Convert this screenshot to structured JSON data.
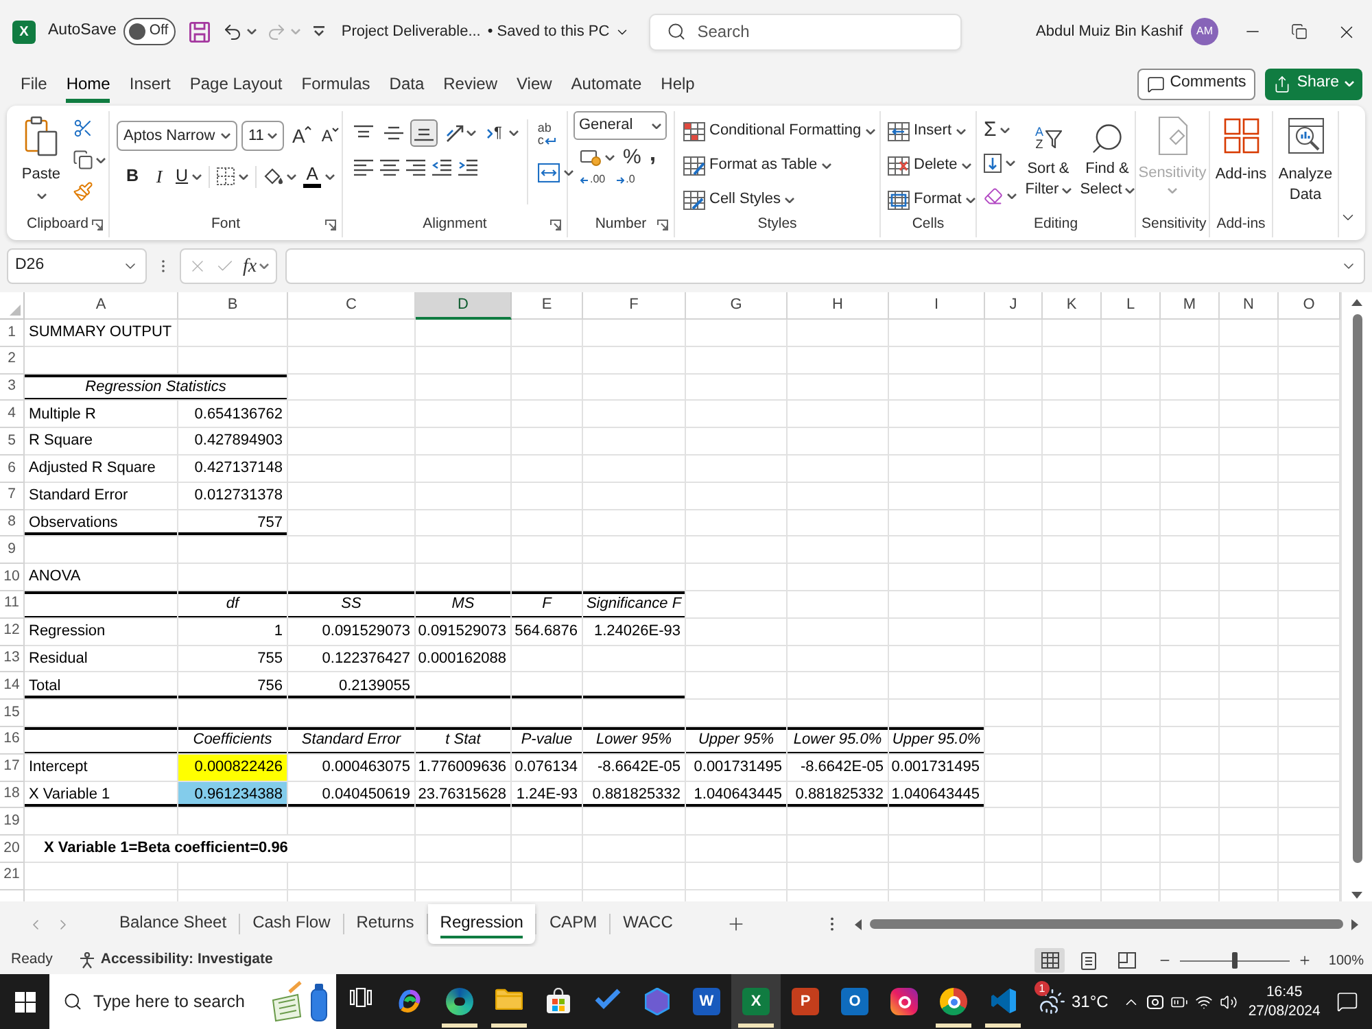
{
  "title_bar": {
    "app_glyph": "X",
    "autosave": "AutoSave",
    "autosave_state": "Off",
    "autosave_on": false,
    "document": "Project Deliverable...",
    "save_status": "• Saved to this PC",
    "search_placeholder": "Search",
    "user": "Abdul Muiz Bin Kashif",
    "initials": "AM"
  },
  "menu": {
    "tabs": [
      {
        "label": "File",
        "selected": false
      },
      {
        "label": "Home",
        "selected": true
      },
      {
        "label": "Insert",
        "selected": false
      },
      {
        "label": "Page Layout",
        "selected": false
      },
      {
        "label": "Formulas",
        "selected": false
      },
      {
        "label": "Data",
        "selected": false
      },
      {
        "label": "Review",
        "selected": false
      },
      {
        "label": "View",
        "selected": false
      },
      {
        "label": "Automate",
        "selected": false
      },
      {
        "label": "Help",
        "selected": false
      }
    ],
    "comments": "Comments",
    "share": "Share"
  },
  "ribbon": {
    "clipboard": {
      "paste": "Paste",
      "label": "Clipboard"
    },
    "font": {
      "name": "Aptos Narrow",
      "size": "11",
      "grow": "A",
      "shrink": "A",
      "bold": "B",
      "italic": "I",
      "underline": "U",
      "color_letter": "A",
      "label": "Font"
    },
    "alignment": {
      "vertical": [
        {
          "kind": "top",
          "selected": false
        },
        {
          "kind": "middle",
          "selected": false
        },
        {
          "kind": "bottom",
          "selected": true
        }
      ],
      "direction_glyph": "¶",
      "wrap": [
        "ab",
        "c"
      ],
      "label": "Alignment"
    },
    "number": {
      "format": "General",
      "percent": "%",
      "comma": ",",
      "more_decimals": ".00",
      "fewer_decimals": ".0",
      "label": "Number"
    },
    "styles": {
      "items": [
        "Conditional Formatting",
        "Format as Table",
        "Cell Styles"
      ],
      "label": "Styles"
    },
    "cells": {
      "items": [
        "Insert",
        "Delete",
        "Format"
      ],
      "label": "Cells"
    },
    "editing": {
      "sum": "Σ",
      "sort_letters": [
        "A",
        "Z"
      ],
      "sort": [
        "Sort &",
        "Filter"
      ],
      "find": [
        "Find &",
        "Select"
      ],
      "label": "Editing"
    },
    "sensitivity": {
      "button": "Sensitivity",
      "disabled": true,
      "label": "Sensitivity"
    },
    "addins": {
      "button": "Add-ins",
      "label": "Add-ins"
    },
    "analyze": {
      "button": [
        "Analyze",
        "Data"
      ]
    }
  },
  "formula_bar": {
    "name_box": "D26",
    "fx": "fx"
  },
  "sheet": {
    "columns": [
      {
        "label": "A",
        "selected": false
      },
      {
        "label": "B",
        "selected": false
      },
      {
        "label": "C",
        "selected": false
      },
      {
        "label": "D",
        "selected": true
      },
      {
        "label": "E",
        "selected": false
      },
      {
        "label": "F",
        "selected": false
      },
      {
        "label": "G",
        "selected": false
      },
      {
        "label": "H",
        "selected": false
      },
      {
        "label": "I",
        "selected": false
      },
      {
        "label": "J",
        "selected": false
      },
      {
        "label": "K",
        "selected": false
      },
      {
        "label": "L",
        "selected": false
      },
      {
        "label": "M",
        "selected": false
      },
      {
        "label": "N",
        "selected": false
      },
      {
        "label": "O",
        "selected": false
      }
    ],
    "rows": [
      {
        "number": "1",
        "cells": [
          {
            "kind": "label",
            "text": "SUMMARY OUTPUT"
          }
        ]
      },
      {
        "number": "2"
      },
      {
        "number": "3",
        "kind": "table-head",
        "cells": [
          {
            "kind": "heading",
            "text": "Regression Statistics"
          },
          {
            "kind": "merged"
          }
        ]
      },
      {
        "number": "4",
        "cells": [
          {
            "kind": "label",
            "text": "Multiple R"
          },
          {
            "kind": "number",
            "text": "0.654136762"
          }
        ]
      },
      {
        "number": "5",
        "cells": [
          {
            "kind": "label",
            "text": "R Square"
          },
          {
            "kind": "number",
            "text": "0.427894903"
          }
        ]
      },
      {
        "number": "6",
        "cells": [
          {
            "kind": "label",
            "text": "Adjusted R Square"
          },
          {
            "kind": "number",
            "text": "0.427137148"
          }
        ]
      },
      {
        "number": "7",
        "cells": [
          {
            "kind": "label",
            "text": "Standard Error"
          },
          {
            "kind": "number",
            "text": "0.012731378"
          }
        ]
      },
      {
        "number": "8",
        "kind": "table-end",
        "cells": [
          {
            "kind": "label",
            "text": "Observations"
          },
          {
            "kind": "number",
            "text": "757"
          }
        ]
      },
      {
        "number": "9"
      },
      {
        "number": "10",
        "cells": [
          {
            "kind": "label",
            "text": "ANOVA"
          }
        ]
      },
      {
        "number": "11",
        "kind": "table-head",
        "cells": [
          {
            "kind": "empty"
          },
          {
            "kind": "heading",
            "text": "df"
          },
          {
            "kind": "heading",
            "text": "SS"
          },
          {
            "kind": "heading",
            "text": "MS"
          },
          {
            "kind": "heading",
            "text": "F"
          },
          {
            "kind": "heading",
            "text": "Significance F"
          }
        ]
      },
      {
        "number": "12",
        "cells": [
          {
            "kind": "label",
            "text": "Regression"
          },
          {
            "kind": "number",
            "text": "1"
          },
          {
            "kind": "number",
            "text": "0.091529073"
          },
          {
            "kind": "number",
            "text": "0.091529073"
          },
          {
            "kind": "number",
            "text": "564.6876"
          },
          {
            "kind": "number",
            "text": "1.24026E-93"
          }
        ]
      },
      {
        "number": "13",
        "cells": [
          {
            "kind": "label",
            "text": "Residual"
          },
          {
            "kind": "number",
            "text": "755"
          },
          {
            "kind": "number",
            "text": "0.122376427"
          },
          {
            "kind": "number",
            "text": "0.000162088"
          }
        ]
      },
      {
        "number": "14",
        "kind": "table-end",
        "cells": [
          {
            "kind": "label",
            "text": "Total"
          },
          {
            "kind": "number",
            "text": "756"
          },
          {
            "kind": "number",
            "text": "0.2139055"
          },
          {
            "kind": "empty"
          },
          {
            "kind": "empty"
          },
          {
            "kind": "empty"
          }
        ]
      },
      {
        "number": "15"
      },
      {
        "number": "16",
        "kind": "table-head",
        "cells": [
          {
            "kind": "empty"
          },
          {
            "kind": "heading",
            "text": "Coefficients"
          },
          {
            "kind": "heading",
            "text": "Standard Error"
          },
          {
            "kind": "heading",
            "text": "t Stat"
          },
          {
            "kind": "heading",
            "text": "P-value"
          },
          {
            "kind": "heading",
            "text": "Lower 95%"
          },
          {
            "kind": "heading",
            "text": "Upper 95%"
          },
          {
            "kind": "heading",
            "text": "Lower 95.0%"
          },
          {
            "kind": "heading",
            "text": "Upper 95.0%"
          }
        ]
      },
      {
        "number": "17",
        "cells": [
          {
            "kind": "label",
            "text": "Intercept"
          },
          {
            "kind": "number",
            "text": "0.000822426",
            "color": "#ffff00"
          },
          {
            "kind": "number",
            "text": "0.000463075"
          },
          {
            "kind": "number",
            "text": "1.776009636"
          },
          {
            "kind": "number",
            "text": "0.076134"
          },
          {
            "kind": "number",
            "text": "-8.6642E-05"
          },
          {
            "kind": "number",
            "text": "0.001731495"
          },
          {
            "kind": "number",
            "text": "-8.6642E-05"
          },
          {
            "kind": "number",
            "text": "0.001731495"
          }
        ]
      },
      {
        "number": "18",
        "kind": "table-end",
        "cells": [
          {
            "kind": "label",
            "text": "X Variable 1"
          },
          {
            "kind": "number",
            "text": "0.961234388",
            "color": "#83cceb"
          },
          {
            "kind": "number",
            "text": "0.040450619"
          },
          {
            "kind": "number",
            "text": "23.76315628"
          },
          {
            "kind": "number",
            "text": "1.24E-93"
          },
          {
            "kind": "number",
            "text": "0.881825332"
          },
          {
            "kind": "number",
            "text": "1.040643445"
          },
          {
            "kind": "number",
            "text": "0.881825332"
          },
          {
            "kind": "number",
            "text": "1.040643445"
          }
        ]
      },
      {
        "number": "19"
      },
      {
        "number": "20",
        "cells": [
          {
            "kind": "note",
            "text": "X Variable 1=Beta coefficient=0.96"
          },
          {
            "kind": "merged"
          },
          {
            "kind": "merged"
          }
        ]
      },
      {
        "number": "21"
      }
    ]
  },
  "sheet_tabs": [
    {
      "label": "Balance Sheet",
      "selected": false
    },
    {
      "label": "Cash Flow",
      "selected": false
    },
    {
      "label": "Returns",
      "selected": false
    },
    {
      "label": "Regression",
      "selected": true
    },
    {
      "label": "CAPM",
      "selected": false
    },
    {
      "label": "WACC",
      "selected": false
    }
  ],
  "status_bar": {
    "ready": "Ready",
    "accessibility": "Accessibility: Investigate",
    "views": [
      {
        "kind": "normal",
        "selected": true
      },
      {
        "kind": "page-layout",
        "selected": false
      },
      {
        "kind": "page-break",
        "selected": false
      }
    ],
    "zoom": {
      "level": 0.5,
      "reading": "100%"
    }
  },
  "taskbar": {
    "search_placeholder": "Type here to search",
    "apps": [
      {
        "kind": "task-view",
        "running": false,
        "selected": false
      },
      {
        "kind": "swirl",
        "running": false,
        "selected": false
      },
      {
        "kind": "wave",
        "running": true,
        "selected": false
      },
      {
        "kind": "folder",
        "running": true,
        "selected": false
      },
      {
        "kind": "bag",
        "running": false,
        "selected": false
      },
      {
        "kind": "tick",
        "running": false,
        "selected": false
      },
      {
        "kind": "hexagon",
        "running": false,
        "selected": false
      },
      {
        "kind": "tile",
        "glyph": "W",
        "color": "#185abd",
        "running": false,
        "selected": false
      },
      {
        "kind": "tile",
        "glyph": "X",
        "color": "#107c41",
        "running": true,
        "selected": true
      },
      {
        "kind": "tile",
        "glyph": "P",
        "color": "#c43e1c",
        "running": false,
        "selected": false
      },
      {
        "kind": "tile",
        "glyph": "O",
        "color": "#0f6cbd",
        "running": false,
        "selected": false
      },
      {
        "kind": "camera",
        "running": false,
        "selected": false
      },
      {
        "kind": "ring",
        "running": true,
        "selected": false
      },
      {
        "kind": "fold",
        "running": true,
        "selected": false
      }
    ],
    "weather": {
      "badge": "1",
      "temperature": "31°C"
    },
    "time": "16:45",
    "date": "27/08/2024"
  }
}
